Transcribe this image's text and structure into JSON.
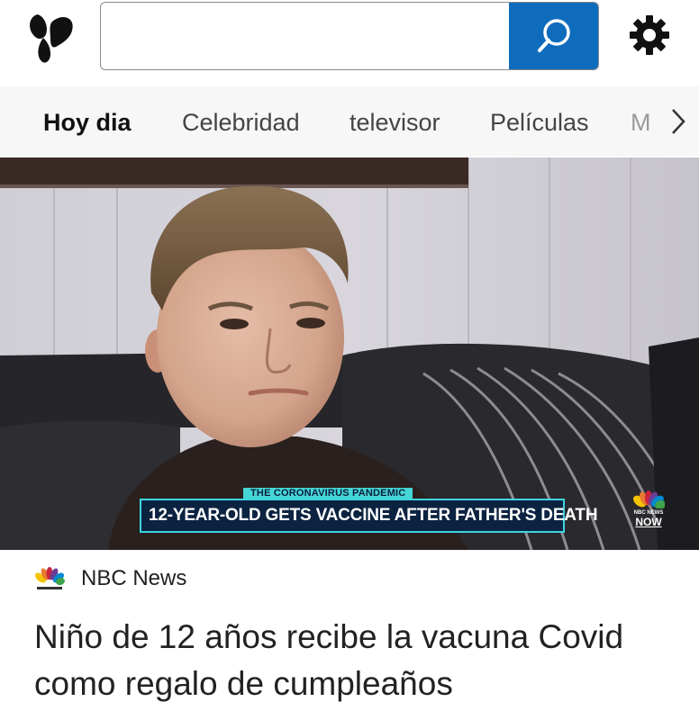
{
  "header": {
    "logo_icon": "butterfly-icon",
    "search": {
      "value": "",
      "placeholder": "",
      "button_icon": "search-icon",
      "accent": "#0f6cbd"
    },
    "settings_icon": "gear-icon"
  },
  "tabs": {
    "items": [
      {
        "label": "Hoy dia",
        "active": true
      },
      {
        "label": "Celebridad",
        "active": false
      },
      {
        "label": "televisor",
        "active": false
      },
      {
        "label": "Películas",
        "active": false
      },
      {
        "label": "M",
        "active": false
      }
    ],
    "more_icon": "chevron-right-icon"
  },
  "article": {
    "video": {
      "overlay_top": "THE CORONAVIRUS PANDEMIC",
      "overlay_main": "12-YEAR-OLD GETS VACCINE AFTER FATHER'S DEATH",
      "bug_small": "NBC NEWS",
      "bug_main": "NOW"
    },
    "source": {
      "name": "NBC News",
      "icon": "nbc-peacock-icon"
    },
    "headline": "Niño de 12 años recibe la vacuna Covid como regalo de cumpleaños"
  }
}
